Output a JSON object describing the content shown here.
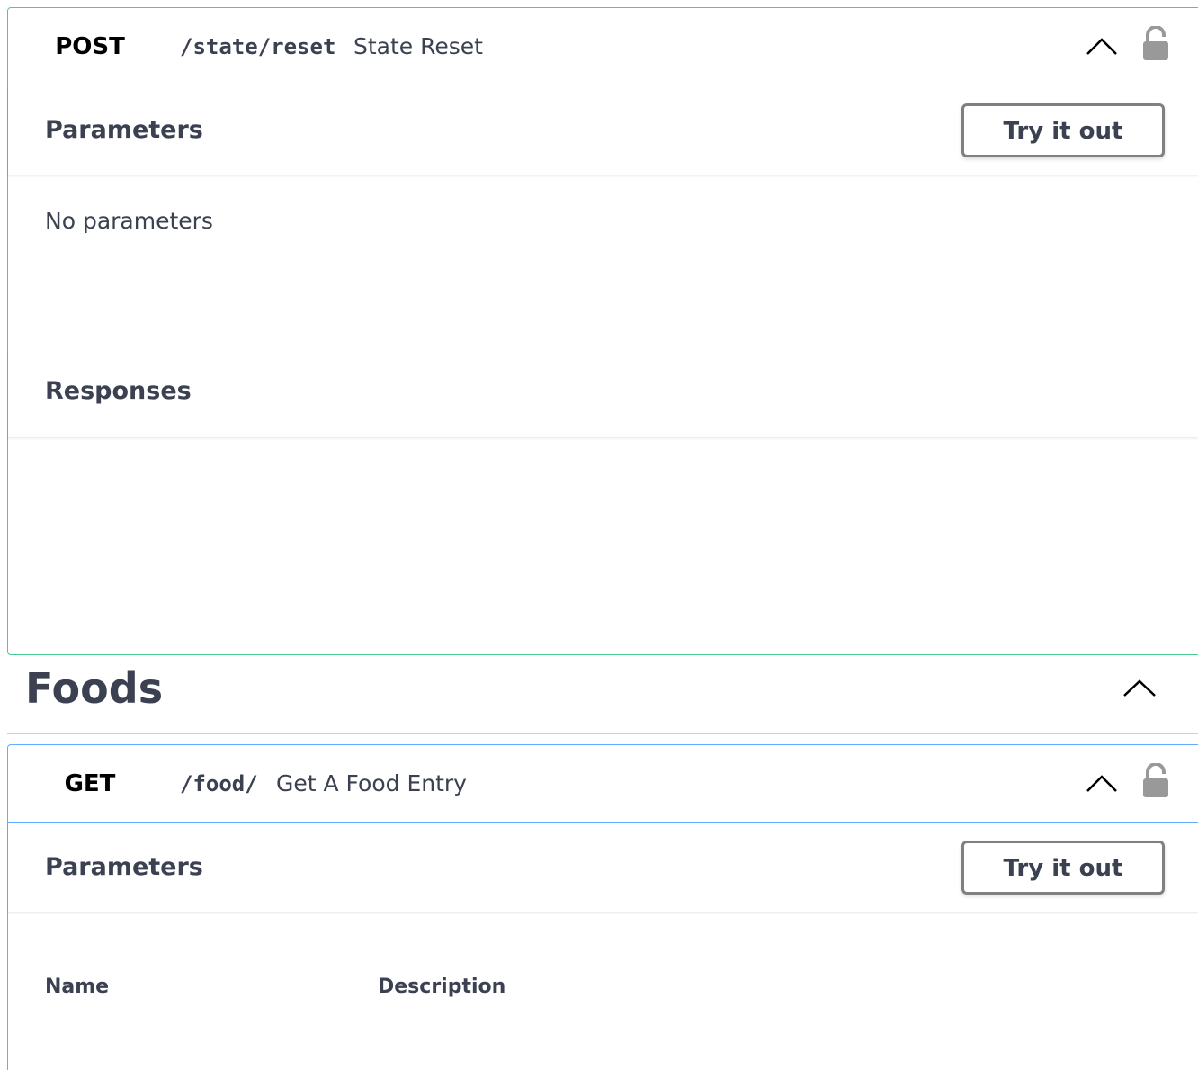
{
  "operations": [
    {
      "method": "POST",
      "path": "/state/reset",
      "summary": "State Reset",
      "parameters_title": "Parameters",
      "try_button": "Try it out",
      "no_parameters": "No parameters",
      "responses_title": "Responses"
    },
    {
      "method": "GET",
      "path": "/food/",
      "summary": "Get A Food Entry",
      "parameters_title": "Parameters",
      "try_button": "Try it out",
      "columns": [
        "Name",
        "Description"
      ]
    }
  ],
  "tag": {
    "title": "Foods"
  },
  "colors": {
    "post_border": "#49cc90",
    "get_border": "#61affe",
    "text": "#3b4151",
    "lock": "#999999"
  },
  "icons": {
    "collapse": "chevron-up-icon",
    "auth": "unlocked-icon"
  }
}
